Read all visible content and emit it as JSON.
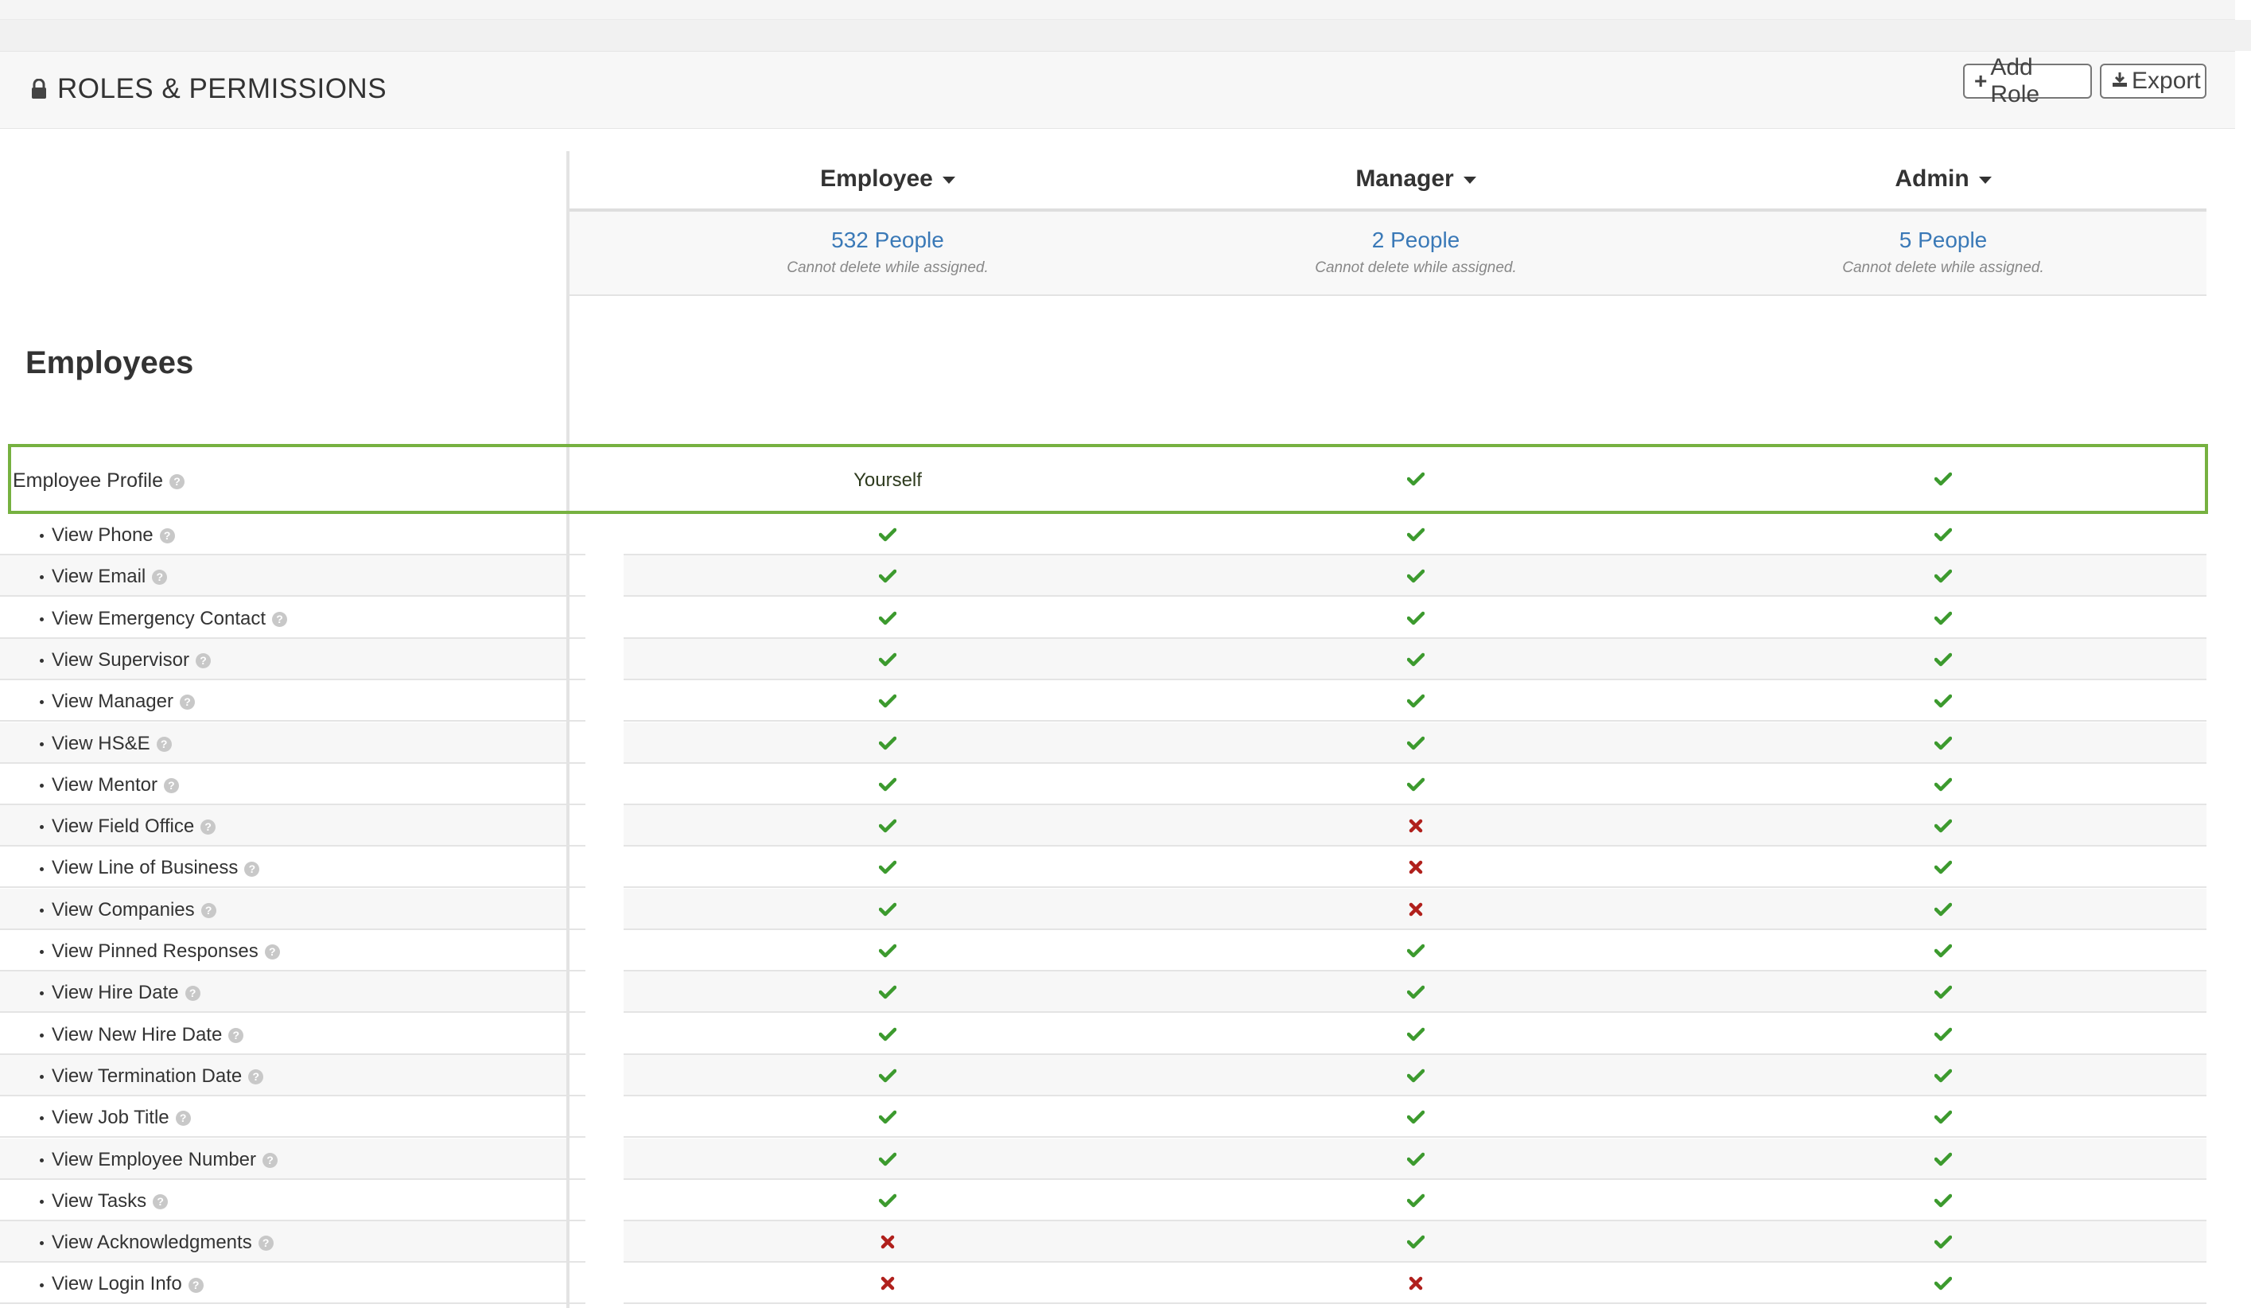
{
  "panel": {
    "title": "ROLES & PERMISSIONS",
    "add_role_label": "Add Role",
    "export_label": "Export"
  },
  "roles": [
    {
      "name": "Employee",
      "people": "532 People",
      "note": "Cannot delete while assigned."
    },
    {
      "name": "Manager",
      "people": "2 People",
      "note": "Cannot delete while assigned."
    },
    {
      "name": "Admin",
      "people": "5 People",
      "note": "Cannot delete while assigned."
    }
  ],
  "section": {
    "title": "Employees",
    "highlighted_row": {
      "label": "Employee Profile",
      "values": [
        "Yourself",
        "check",
        "check"
      ]
    },
    "rows": [
      {
        "label": "View Phone",
        "values": [
          "check",
          "check",
          "check"
        ]
      },
      {
        "label": "View Email",
        "values": [
          "check",
          "check",
          "check"
        ]
      },
      {
        "label": "View Emergency Contact",
        "values": [
          "check",
          "check",
          "check"
        ]
      },
      {
        "label": "View Supervisor",
        "values": [
          "check",
          "check",
          "check"
        ]
      },
      {
        "label": "View Manager",
        "values": [
          "check",
          "check",
          "check"
        ]
      },
      {
        "label": "View HS&E",
        "values": [
          "check",
          "check",
          "check"
        ]
      },
      {
        "label": "View Mentor",
        "values": [
          "check",
          "check",
          "check"
        ]
      },
      {
        "label": "View Field Office",
        "values": [
          "check",
          "cross",
          "check"
        ]
      },
      {
        "label": "View Line of Business",
        "values": [
          "check",
          "cross",
          "check"
        ]
      },
      {
        "label": "View Companies",
        "values": [
          "check",
          "cross",
          "check"
        ]
      },
      {
        "label": "View Pinned Responses",
        "values": [
          "check",
          "check",
          "check"
        ]
      },
      {
        "label": "View Hire Date",
        "values": [
          "check",
          "check",
          "check"
        ]
      },
      {
        "label": "View New Hire Date",
        "values": [
          "check",
          "check",
          "check"
        ]
      },
      {
        "label": "View Termination Date",
        "values": [
          "check",
          "check",
          "check"
        ]
      },
      {
        "label": "View Job Title",
        "values": [
          "check",
          "check",
          "check"
        ]
      },
      {
        "label": "View Employee Number",
        "values": [
          "check",
          "check",
          "check"
        ]
      },
      {
        "label": "View Tasks",
        "values": [
          "check",
          "check",
          "check"
        ]
      },
      {
        "label": "View Acknowledgments",
        "values": [
          "cross",
          "check",
          "check"
        ]
      },
      {
        "label": "View Login Info",
        "values": [
          "cross",
          "cross",
          "check"
        ]
      }
    ]
  },
  "icons": {
    "lock": "lock-icon",
    "plus": "plus-icon",
    "download": "download-icon",
    "help": "question-circle-icon",
    "check": "check-icon",
    "cross": "cross-icon"
  },
  "colors": {
    "check": "#3c9a2e",
    "cross": "#b0201c",
    "link": "#3a79b7",
    "highlight_border": "#76b140"
  }
}
